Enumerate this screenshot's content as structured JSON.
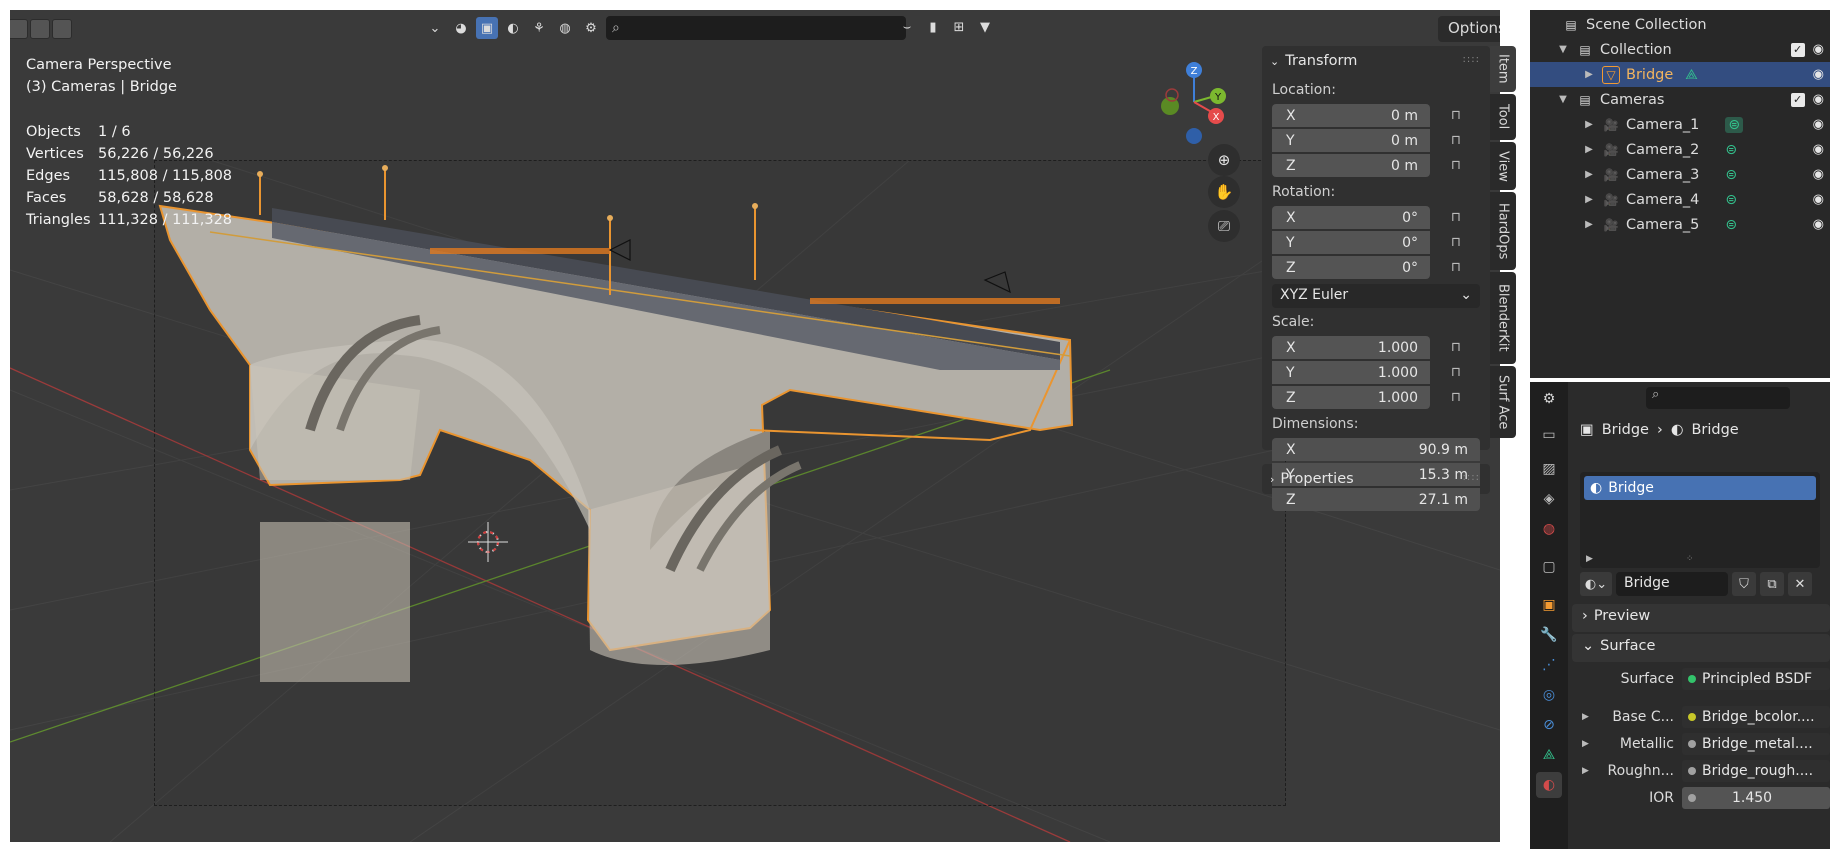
{
  "viewport": {
    "view_name": "Camera Perspective",
    "collection_info": "(3) Cameras | Bridge",
    "stats": [
      {
        "label": "Objects",
        "value": "1 / 6"
      },
      {
        "label": "Vertices",
        "value": "56,226 / 56,226"
      },
      {
        "label": "Edges",
        "value": "115,808 / 115,808"
      },
      {
        "label": "Faces",
        "value": "58,628 / 58,628"
      },
      {
        "label": "Triangles",
        "value": "111,328 / 111,328"
      }
    ],
    "options_label": "Options",
    "gizmo": {
      "z": "Z",
      "y": "Y",
      "x": "X"
    }
  },
  "npanel": {
    "transform_title": "Transform",
    "location_label": "Location:",
    "location": [
      {
        "axis": "X",
        "value": "0 m"
      },
      {
        "axis": "Y",
        "value": "0 m"
      },
      {
        "axis": "Z",
        "value": "0 m"
      }
    ],
    "rotation_label": "Rotation:",
    "rotation": [
      {
        "axis": "X",
        "value": "0°"
      },
      {
        "axis": "Y",
        "value": "0°"
      },
      {
        "axis": "Z",
        "value": "0°"
      }
    ],
    "rotation_mode": "XYZ Euler",
    "scale_label": "Scale:",
    "scale": [
      {
        "axis": "X",
        "value": "1.000"
      },
      {
        "axis": "Y",
        "value": "1.000"
      },
      {
        "axis": "Z",
        "value": "1.000"
      }
    ],
    "dimensions_label": "Dimensions:",
    "dimensions": [
      {
        "axis": "X",
        "value": "90.9 m"
      },
      {
        "axis": "Y",
        "value": "15.3 m"
      },
      {
        "axis": "Z",
        "value": "27.1 m"
      }
    ],
    "properties_title": "Properties",
    "tabs": [
      "Item",
      "Tool",
      "View",
      "HardOps",
      "BlenderKit",
      "Surf Ace"
    ]
  },
  "outliner": {
    "scene_collection": "Scene Collection",
    "collection": "Collection",
    "bridge": "Bridge",
    "cameras": "Cameras",
    "camera_items": [
      "Camera_1",
      "Camera_2",
      "Camera_3",
      "Camera_4",
      "Camera_5"
    ]
  },
  "properties": {
    "breadcrumb_object": "Bridge",
    "breadcrumb_material": "Bridge",
    "slot_name": "Bridge",
    "material_name": "Bridge",
    "preview_label": "Preview",
    "surface_panel": "Surface",
    "surface_label": "Surface",
    "surface_value": "Principled BSDF",
    "sockets": [
      {
        "label": "Base C...",
        "value": "Bridge_bcolor....",
        "dot": "#c7c729"
      },
      {
        "label": "Metallic",
        "value": "Bridge_metal....",
        "dot": "#a1a1a1"
      },
      {
        "label": "Roughn...",
        "value": "Bridge_rough....",
        "dot": "#a1a1a1"
      }
    ],
    "ior_label": "IOR",
    "ior_value": "1.450"
  },
  "colors": {
    "accent": "#4772b3",
    "selection_outline": "#f29a32",
    "outliner_selected": "#334d80"
  }
}
